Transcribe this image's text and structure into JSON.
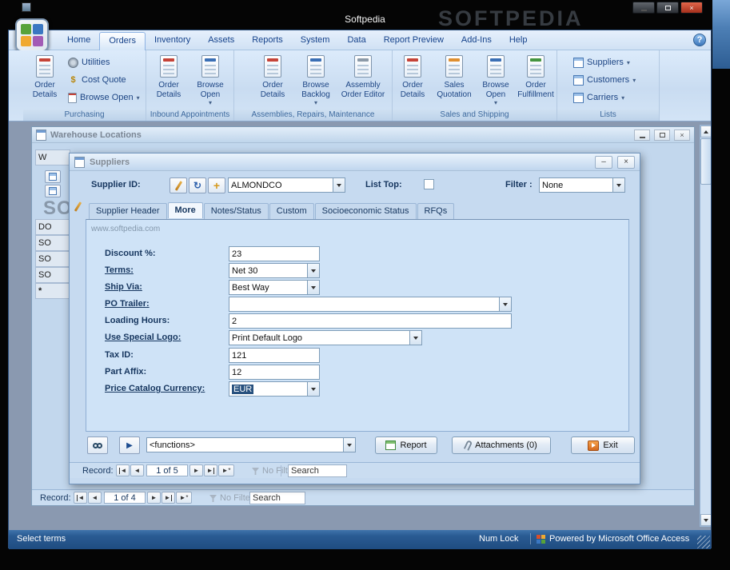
{
  "titlebar": {
    "title": "Softpedia"
  },
  "watermarks": {
    "desktop": "SOFTPEDIA",
    "form": "www.softpedia.com",
    "list": "SO"
  },
  "icons": {
    "help": "?",
    "dropdown_arrow": "▾",
    "minimize": "–",
    "close": "×",
    "run": "▶",
    "dollar": "$",
    "refresh": "↻",
    "add": "+",
    "nav_first": "◄",
    "nav_prev": "◄",
    "nav_next": "►",
    "nav_last": "►",
    "nav_new": "►*",
    "new_row": "*"
  },
  "ribbon": {
    "tabs": [
      {
        "label": "Home"
      },
      {
        "label": "Orders"
      },
      {
        "label": "Inventory"
      },
      {
        "label": "Assets"
      },
      {
        "label": "Reports"
      },
      {
        "label": "System"
      },
      {
        "label": "Data"
      },
      {
        "label": "Report Preview"
      },
      {
        "label": "Add-Ins"
      },
      {
        "label": "Help"
      }
    ],
    "groups": {
      "purchasing": {
        "label": "Purchasing",
        "order_details": "Order Details",
        "utilities": "Utilities",
        "cost_quote": "Cost Quote",
        "browse_open": "Browse Open"
      },
      "inbound": {
        "label": "Inbound Appointments",
        "order_details": "Order Details",
        "browse_open": "Browse Open"
      },
      "assemblies": {
        "label": "Assemblies, Repairs, Maintenance",
        "order_details": "Order Details",
        "browse_backlog": "Browse Backlog",
        "assembly_order_editor": "Assembly Order Editor"
      },
      "sales": {
        "label": "Sales and Shipping",
        "order_details": "Order Details",
        "sales_quotation": "Sales Quotation",
        "browse_open": "Browse Open",
        "order_fulfillment": "Order Fulfillment"
      },
      "lists": {
        "label": "Lists",
        "suppliers": "Suppliers",
        "customers": "Customers",
        "carriers": "Carriers"
      }
    }
  },
  "warehouse": {
    "title": "Warehouse Locations",
    "header_cell": "W",
    "rows": [
      "DO",
      "SO",
      "SO",
      "SO"
    ],
    "record_nav": {
      "label": "Record:",
      "position": "1 of 4",
      "no_filter": "No Filter",
      "search": "Search"
    }
  },
  "suppliers": {
    "title": "Suppliers",
    "supplier_id_label": "Supplier ID:",
    "supplier_id_value": "ALMONDCO",
    "list_top_label": "List Top:",
    "list_top_checked": false,
    "filter_label": "Filter :",
    "filter_value": "None",
    "tabs": [
      {
        "label": "Supplier Header"
      },
      {
        "label": "More"
      },
      {
        "label": "Notes/Status"
      },
      {
        "label": "Custom"
      },
      {
        "label": "Socioeconomic Status"
      },
      {
        "label": "RFQs"
      }
    ],
    "fields": [
      {
        "label": "Discount %:",
        "value": "23"
      },
      {
        "label": "Terms:",
        "value": "Net 30"
      },
      {
        "label": "Ship Via:",
        "value": "Best Way"
      },
      {
        "label": "PO Trailer:",
        "value": ""
      },
      {
        "label": "Loading Hours:",
        "value": "2"
      },
      {
        "label": "Use Special Logo:",
        "value": "Print Default Logo"
      },
      {
        "label": "Tax ID:",
        "value": "121"
      },
      {
        "label": "Part Affix:",
        "value": "12"
      },
      {
        "label": "Price Catalog Currency:",
        "value": "EUR"
      }
    ],
    "functions_combo": "<functions>",
    "report_button": "Report",
    "attachments_button": "Attachments (0)",
    "exit_button": "Exit",
    "record_nav": {
      "label": "Record:",
      "position": "1 of 5",
      "no_filter": "No Filter",
      "search": "Search"
    }
  },
  "statusbar": {
    "left": "Select terms",
    "numlock": "Num Lock",
    "right": "Powered by Microsoft Office Access"
  }
}
